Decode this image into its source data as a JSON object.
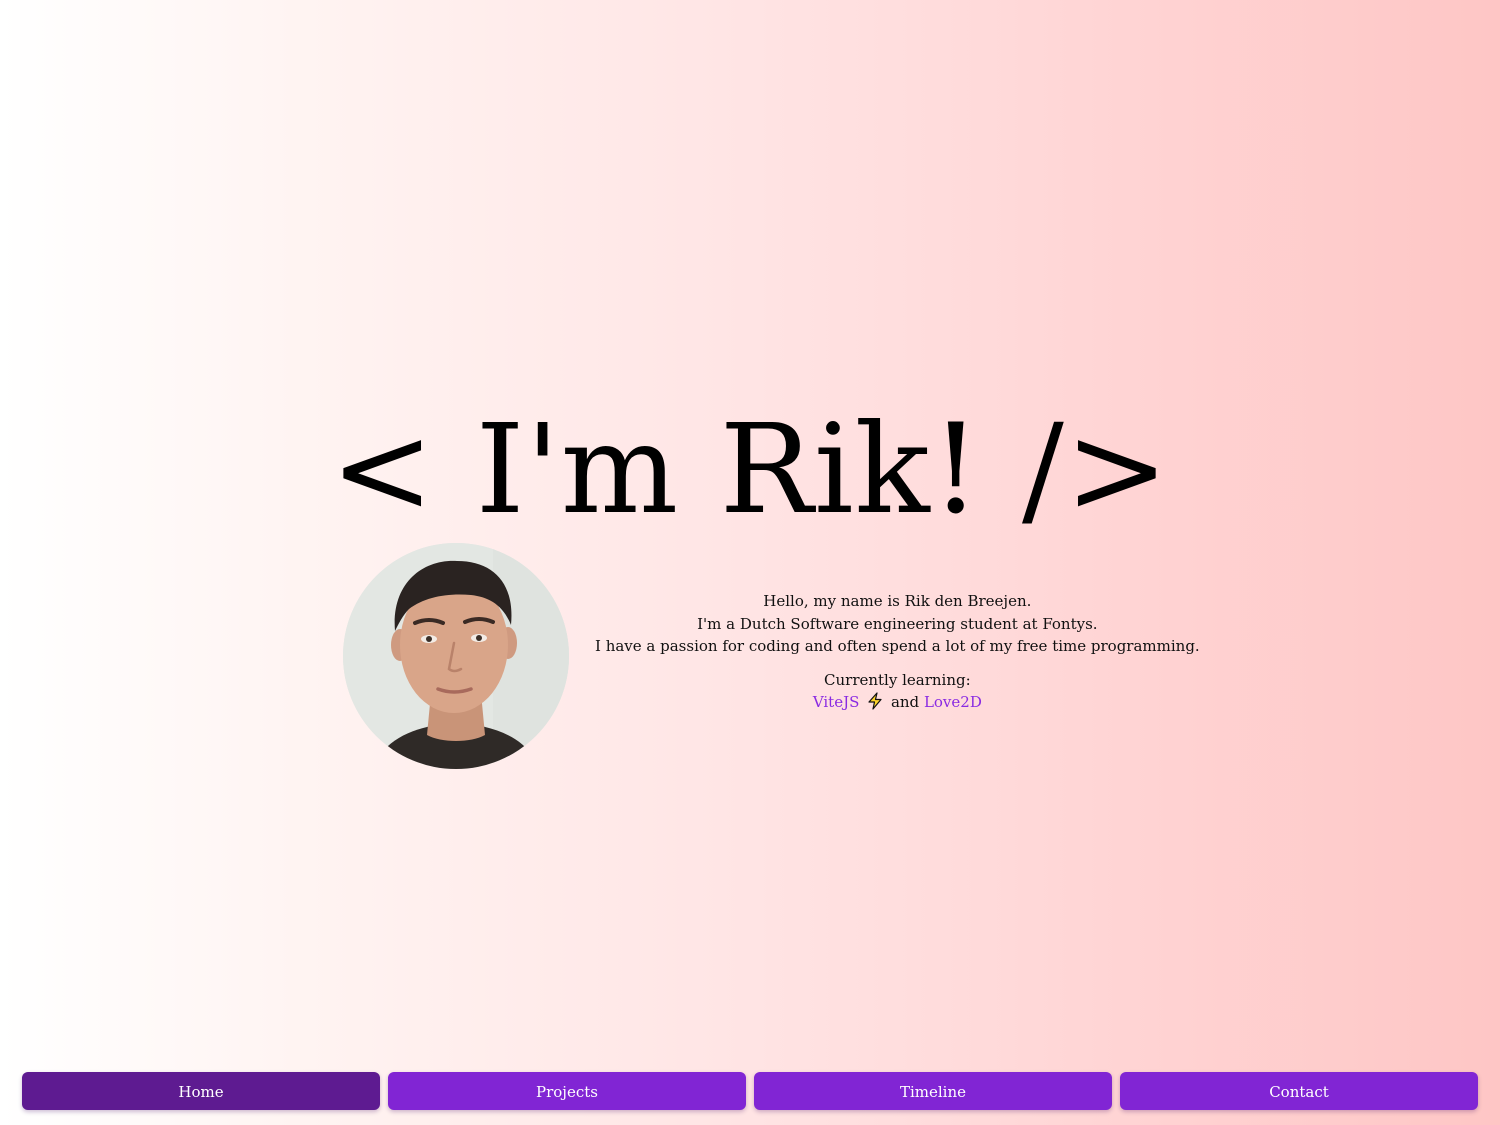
{
  "hero": {
    "title": "< I'm Rik! />"
  },
  "bio": {
    "line1": "Hello, my name is Rik den Breejen.",
    "line2": "I'm a Dutch Software engineering student at Fontys.",
    "line3": "I have a passion for coding and often spend a lot of my free time programming.",
    "learning_label": "Currently learning:",
    "link1": "ViteJS",
    "connector": "and",
    "link2": "Love2D"
  },
  "nav": {
    "items": [
      {
        "label": "Home",
        "active": true
      },
      {
        "label": "Projects"
      },
      {
        "label": "Timeline"
      },
      {
        "label": "Contact"
      }
    ]
  },
  "colors": {
    "accent": "#8125d4",
    "accent_active": "#5e1b91",
    "link": "#8a2be2"
  },
  "icons": {
    "vite": "lightning-bolt-icon",
    "avatar": "profile-photo"
  }
}
